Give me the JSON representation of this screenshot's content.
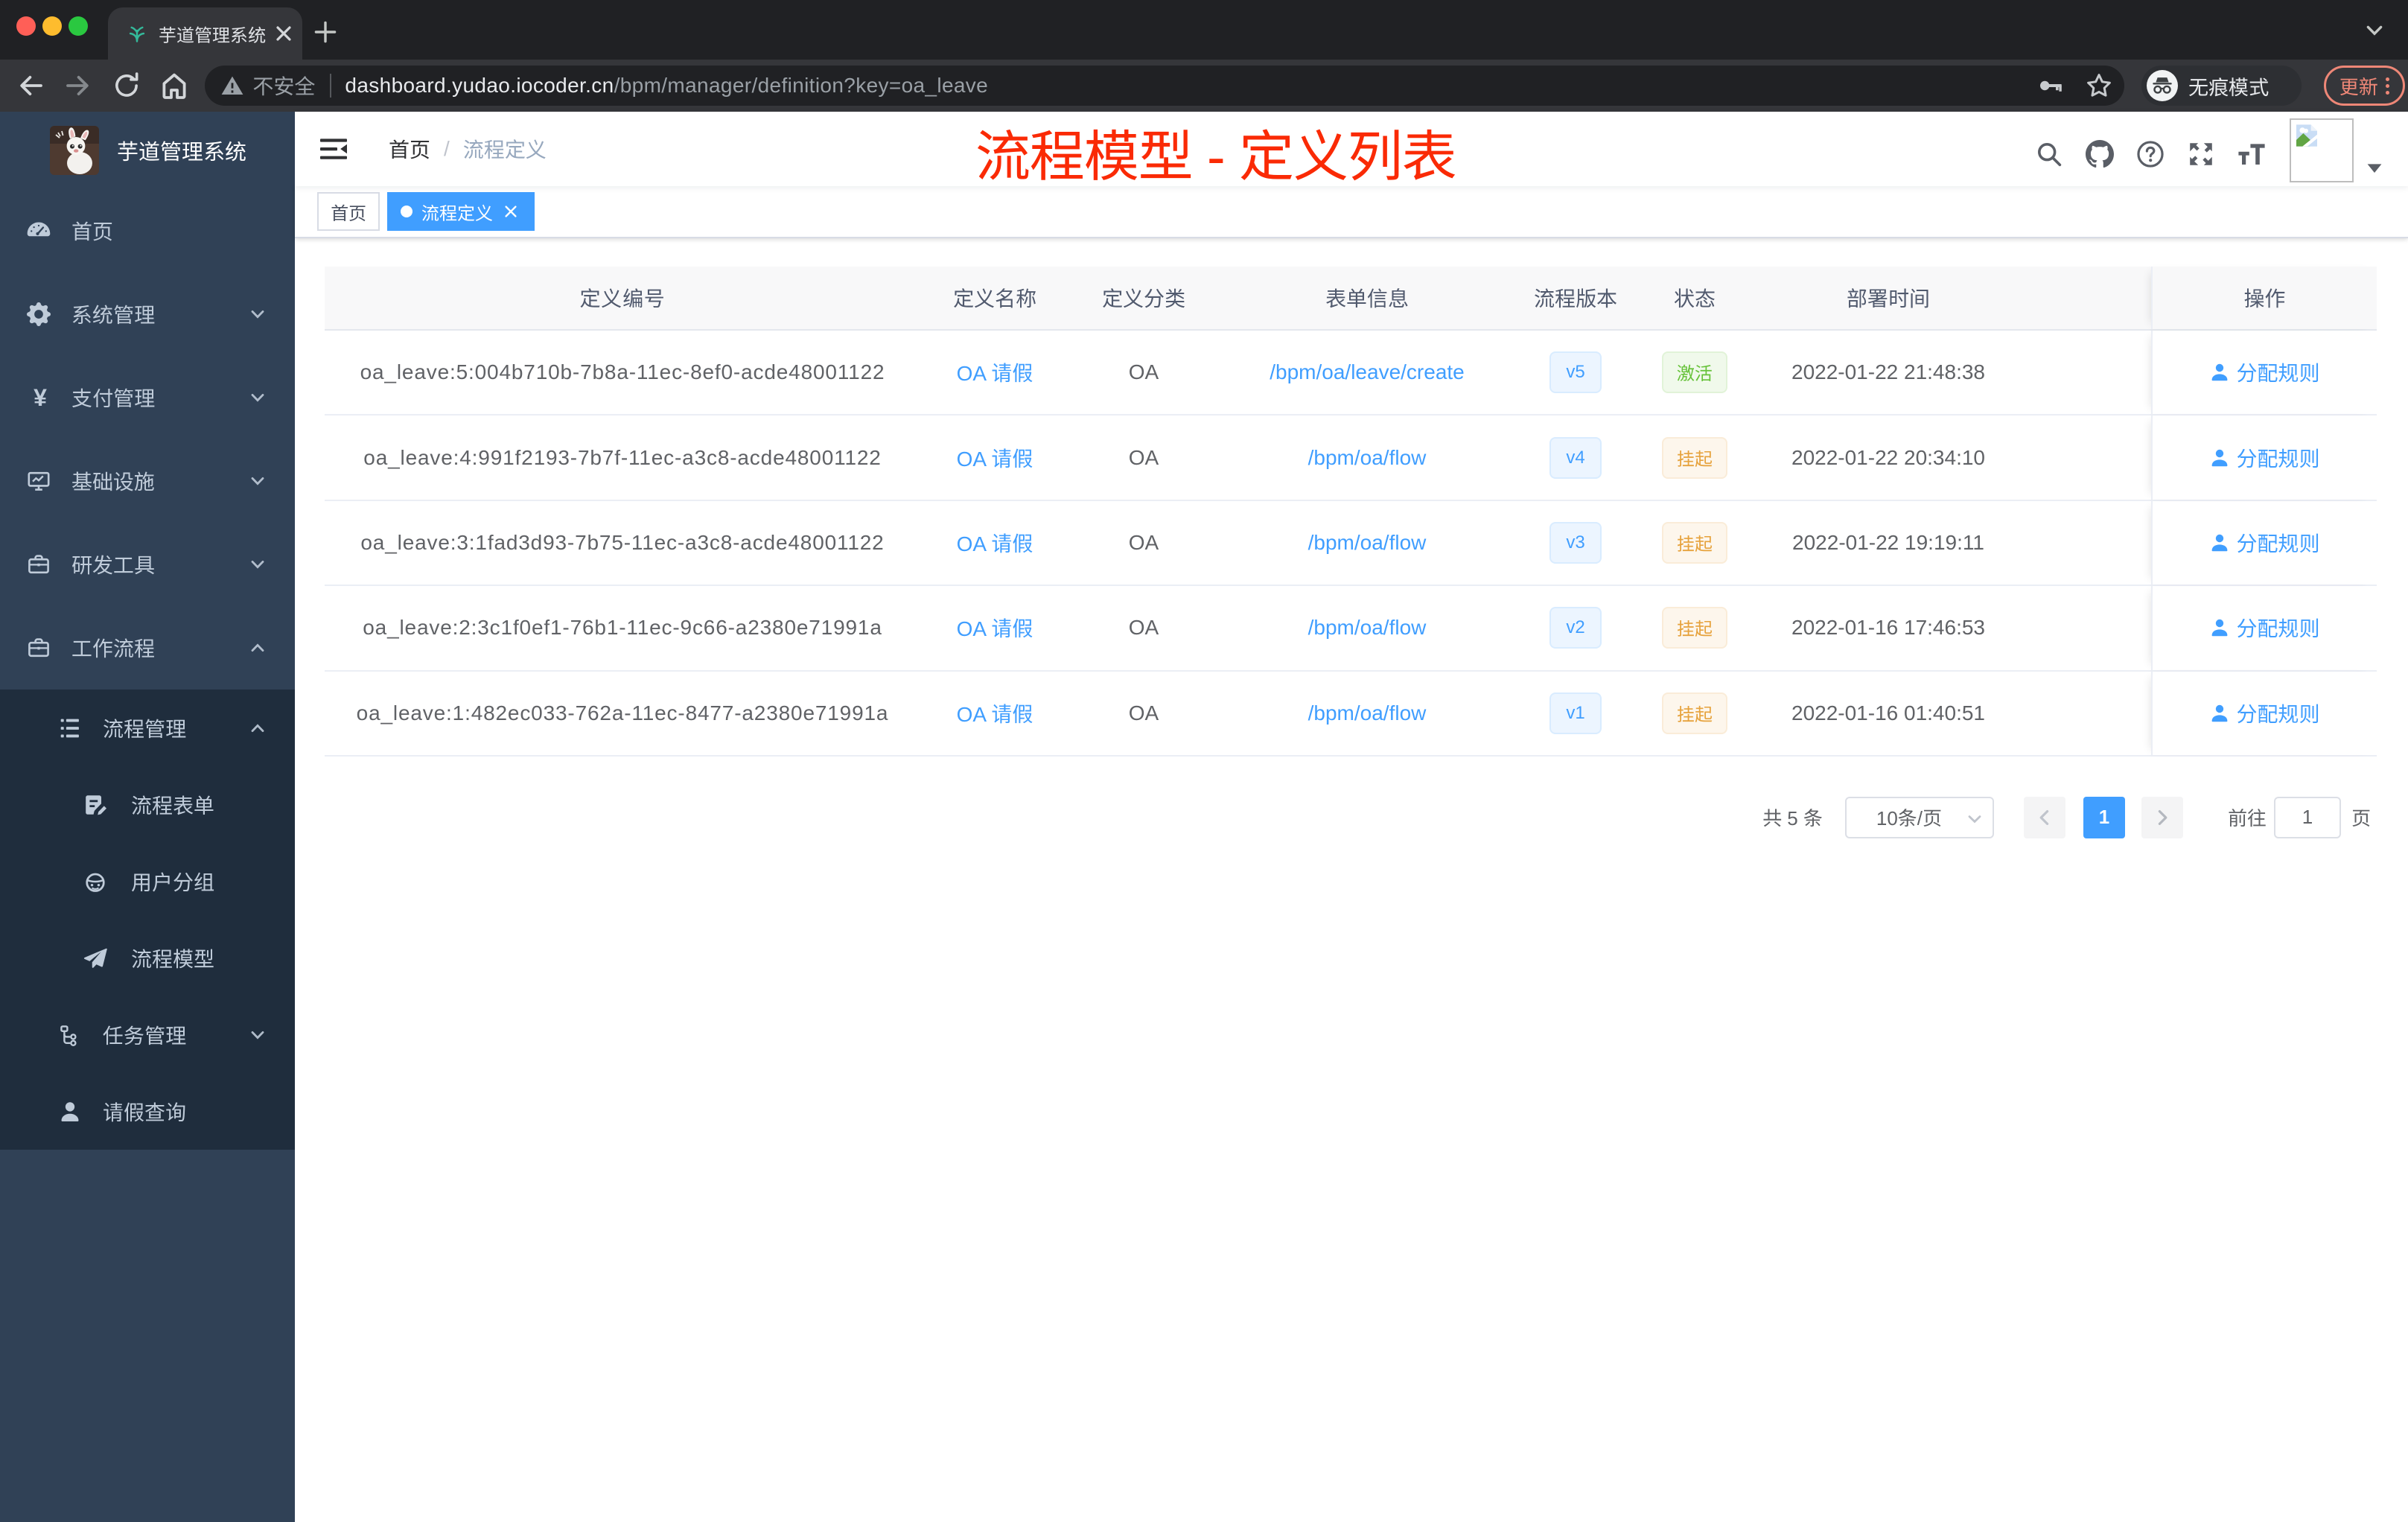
{
  "browser": {
    "tab_title": "芋道管理系统",
    "address": {
      "security_label": "不安全",
      "host": "dashboard.yudao.iocoder.cn",
      "path": "/bpm/manager/definition?key=oa_leave"
    },
    "incognito_label": "无痕模式",
    "update_label": "更新"
  },
  "sidebar": {
    "logo_title": "芋道管理系统",
    "items": [
      {
        "label": "首页"
      },
      {
        "label": "系统管理"
      },
      {
        "label": "支付管理"
      },
      {
        "label": "基础设施"
      },
      {
        "label": "研发工具"
      },
      {
        "label": "工作流程"
      },
      {
        "label": "流程管理"
      },
      {
        "label": "流程表单"
      },
      {
        "label": "用户分组"
      },
      {
        "label": "流程模型"
      },
      {
        "label": "任务管理"
      },
      {
        "label": "请假查询"
      }
    ]
  },
  "navbar": {
    "breadcrumb": {
      "home": "首页",
      "separator": "/",
      "current": "流程定义"
    },
    "annotation": "流程模型 - 定义列表"
  },
  "tags": [
    {
      "label": "首页",
      "active": false
    },
    {
      "label": "流程定义",
      "active": true
    }
  ],
  "table": {
    "headers": {
      "id": "定义编号",
      "name": "定义名称",
      "category": "定义分类",
      "form": "表单信息",
      "version": "流程版本",
      "status": "状态",
      "deploy_time": "部署时间",
      "actions": "操作"
    },
    "rows": [
      {
        "id": "oa_leave:5:004b710b-7b8a-11ec-8ef0-acde48001122",
        "name": "OA 请假",
        "category": "OA",
        "form": "/bpm/oa/leave/create",
        "version": "v5",
        "status": "激活",
        "status_type": "success",
        "deploy_time": "2022-01-22 21:48:38",
        "action": "分配规则"
      },
      {
        "id": "oa_leave:4:991f2193-7b7f-11ec-a3c8-acde48001122",
        "name": "OA 请假",
        "category": "OA",
        "form": "/bpm/oa/flow",
        "version": "v4",
        "status": "挂起",
        "status_type": "warning",
        "deploy_time": "2022-01-22 20:34:10",
        "action": "分配规则"
      },
      {
        "id": "oa_leave:3:1fad3d93-7b75-11ec-a3c8-acde48001122",
        "name": "OA 请假",
        "category": "OA",
        "form": "/bpm/oa/flow",
        "version": "v3",
        "status": "挂起",
        "status_type": "warning",
        "deploy_time": "2022-01-22 19:19:11",
        "action": "分配规则"
      },
      {
        "id": "oa_leave:2:3c1f0ef1-76b1-11ec-9c66-a2380e71991a",
        "name": "OA 请假",
        "category": "OA",
        "form": "/bpm/oa/flow",
        "version": "v2",
        "status": "挂起",
        "status_type": "warning",
        "deploy_time": "2022-01-16 17:46:53",
        "action": "分配规则"
      },
      {
        "id": "oa_leave:1:482ec033-762a-11ec-8477-a2380e71991a",
        "name": "OA 请假",
        "category": "OA",
        "form": "/bpm/oa/flow",
        "version": "v1",
        "status": "挂起",
        "status_type": "warning",
        "deploy_time": "2022-01-16 01:40:51",
        "action": "分配规则"
      }
    ]
  },
  "pagination": {
    "total_label": "共 5 条",
    "page_size_label": "10条/页",
    "current_page": "1",
    "jump_prefix": "前往",
    "jump_value": "1",
    "jump_suffix": "页"
  },
  "colors": {
    "accent": "#409eff",
    "success": "#67c23a",
    "warning": "#e6a23c",
    "annotation_red": "#fa2a05",
    "sidebar_bg": "#304156",
    "submenu_bg": "#1f2d3d"
  }
}
